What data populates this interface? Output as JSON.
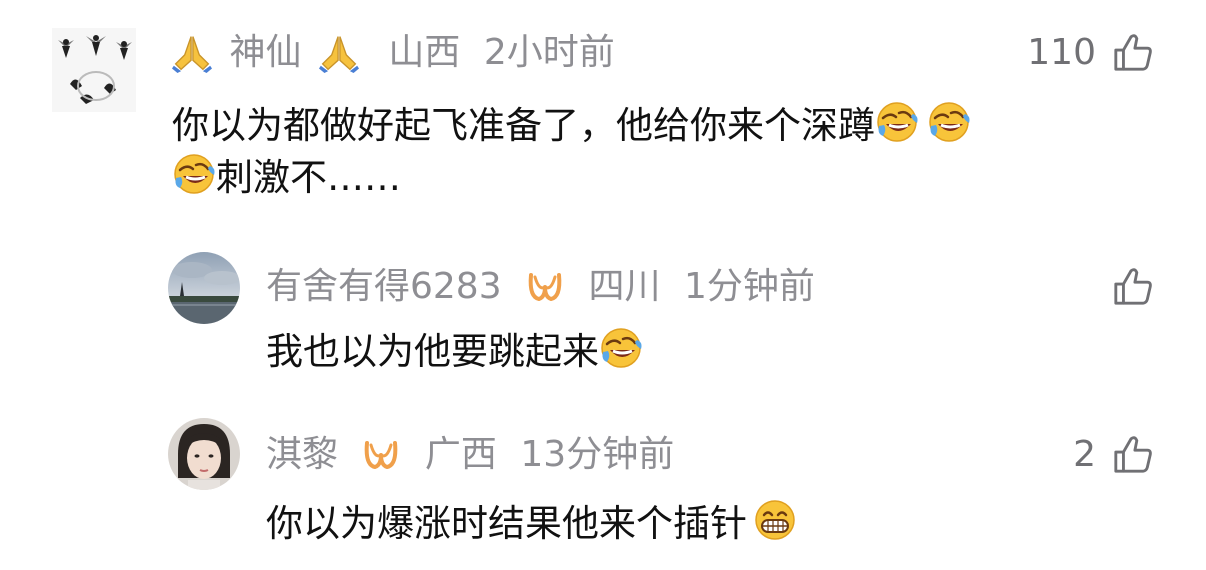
{
  "comments": [
    {
      "username": "神仙",
      "location": "山西",
      "time": "2小时前",
      "likes": "110",
      "text_line1": "你以为都做好起飞准备了，他给你来个深蹲",
      "text_line2": "刺激不……",
      "emoji": "rolling-laughing",
      "name_decoration_icon": "folded-hands-icon"
    },
    {
      "username": "有舍有得6283",
      "location": "四川",
      "time": "1分钟前",
      "likes": "",
      "text": "我也以为他要跳起来",
      "emoji": "rolling-laughing",
      "badge_icon": "vip-badge-icon"
    },
    {
      "username": "淇黎",
      "location": "广西",
      "time": "13分钟前",
      "likes": "2",
      "text": "你以为爆涨时结果他来个插针",
      "emoji": "grinning-face",
      "badge_icon": "vip-badge-icon"
    }
  ],
  "colors": {
    "meta": "#8e8e93",
    "text": "#111111",
    "badge": "#f0a04b",
    "like_icon": "#707074"
  }
}
